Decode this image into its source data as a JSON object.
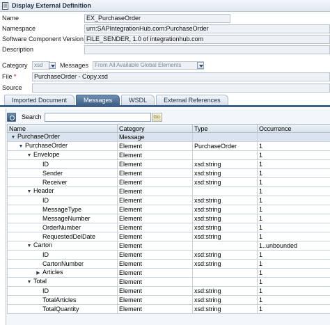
{
  "window": {
    "title": "Display External Definition"
  },
  "form": {
    "name_label": "Name",
    "name_value": "EX_PurchaseOrder",
    "namespace_label": "Namespace",
    "namespace_value": "urn:SAPIntegrationHub.com:PurchaseOrder",
    "swcv_label": "Software Component Version",
    "swcv_value": "FILE_SENDER, 1.0 of integrationhub.com",
    "description_label": "Description",
    "description_value": "",
    "category_label": "Category",
    "category_value": "xsd",
    "messages_label": "Messages",
    "messages_value": "From All Available Global Elements",
    "file_label": "File",
    "file_required": "*",
    "file_value": "PurchaseOrder - Copy.xsd",
    "source_label": "Source",
    "source_value": ""
  },
  "tabs": [
    {
      "label": "Imported Document",
      "active": false
    },
    {
      "label": "Messages",
      "active": true
    },
    {
      "label": "WSDL",
      "active": false
    },
    {
      "label": "External References",
      "active": false
    }
  ],
  "search": {
    "label": "Search",
    "value": "",
    "go_label": "Go"
  },
  "table": {
    "columns": [
      "Name",
      "Category",
      "Type",
      "Occurrence"
    ],
    "rows": [
      {
        "name": "PurchaseOrder",
        "level": 0,
        "toggle": "expanded",
        "category": "Message",
        "type": "",
        "occurrence": "",
        "selected": true
      },
      {
        "name": "PurchaseOrder",
        "level": 1,
        "toggle": "expanded",
        "category": "Element",
        "type": "PurchaseOrder",
        "occurrence": "1",
        "selected": false
      },
      {
        "name": "Envelope",
        "level": 2,
        "toggle": "expanded",
        "category": "Element",
        "type": "",
        "occurrence": "1",
        "selected": false
      },
      {
        "name": "ID",
        "level": 3,
        "toggle": "",
        "category": "Element",
        "type": "xsd:string",
        "occurrence": "1",
        "selected": false
      },
      {
        "name": "Sender",
        "level": 3,
        "toggle": "",
        "category": "Element",
        "type": "xsd:string",
        "occurrence": "1",
        "selected": false
      },
      {
        "name": "Receiver",
        "level": 3,
        "toggle": "",
        "category": "Element",
        "type": "xsd:string",
        "occurrence": "1",
        "selected": false
      },
      {
        "name": "Header",
        "level": 2,
        "toggle": "expanded",
        "category": "Element",
        "type": "",
        "occurrence": "1",
        "selected": false
      },
      {
        "name": "ID",
        "level": 3,
        "toggle": "",
        "category": "Element",
        "type": "xsd:string",
        "occurrence": "1",
        "selected": false
      },
      {
        "name": "MessageType",
        "level": 3,
        "toggle": "",
        "category": "Element",
        "type": "xsd:string",
        "occurrence": "1",
        "selected": false
      },
      {
        "name": "MessageNumber",
        "level": 3,
        "toggle": "",
        "category": "Element",
        "type": "xsd:string",
        "occurrence": "1",
        "selected": false
      },
      {
        "name": "OrderNumber",
        "level": 3,
        "toggle": "",
        "category": "Element",
        "type": "xsd:string",
        "occurrence": "1",
        "selected": false
      },
      {
        "name": "RequestedDelDate",
        "level": 3,
        "toggle": "",
        "category": "Element",
        "type": "xsd:string",
        "occurrence": "1",
        "selected": false
      },
      {
        "name": "Carton",
        "level": 2,
        "toggle": "expanded",
        "category": "Element",
        "type": "",
        "occurrence": "1..unbounded",
        "selected": false
      },
      {
        "name": "ID",
        "level": 3,
        "toggle": "",
        "category": "Element",
        "type": "xsd:string",
        "occurrence": "1",
        "selected": false
      },
      {
        "name": "CartonNumber",
        "level": 3,
        "toggle": "",
        "category": "Element",
        "type": "xsd:string",
        "occurrence": "1",
        "selected": false
      },
      {
        "name": "Articles",
        "level": 3,
        "toggle": "collapsed",
        "category": "Element",
        "type": "",
        "occurrence": "1",
        "selected": false
      },
      {
        "name": "Total",
        "level": 2,
        "toggle": "expanded",
        "category": "Element",
        "type": "",
        "occurrence": "1",
        "selected": false
      },
      {
        "name": "ID",
        "level": 3,
        "toggle": "",
        "category": "Element",
        "type": "xsd:string",
        "occurrence": "1",
        "selected": false
      },
      {
        "name": "TotalArticles",
        "level": 3,
        "toggle": "",
        "category": "Element",
        "type": "xsd:string",
        "occurrence": "1",
        "selected": false
      },
      {
        "name": "TotalQuantity",
        "level": 3,
        "toggle": "",
        "category": "Element",
        "type": "xsd:string",
        "occurrence": "1",
        "selected": false
      }
    ]
  },
  "colors": {
    "tab_active": "#3f6188",
    "field_bg": "#eef2f6",
    "selected_row": "#dbe4ee"
  }
}
